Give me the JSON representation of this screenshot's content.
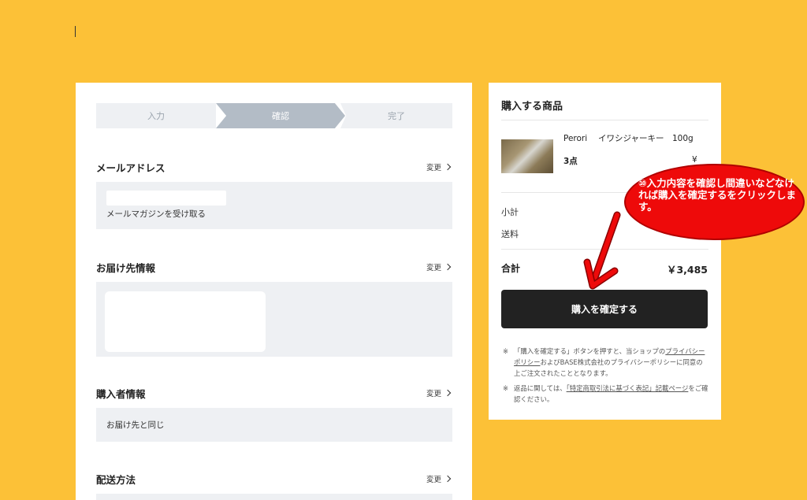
{
  "steps": [
    "入力",
    "確認",
    "完了"
  ],
  "left": {
    "change_label": "変更",
    "email_section": {
      "title": "メールアドレス",
      "newsletter": "メールマガジンを受け取る"
    },
    "shipping_section": {
      "title": "お届け先情報"
    },
    "buyer_section": {
      "title": "購入者情報",
      "value": "お届け先と同じ"
    },
    "delivery_section": {
      "title": "配送方法"
    }
  },
  "right": {
    "title": "購入する商品",
    "product": {
      "name": "Perori　 イワシジャーキー　100g",
      "qty": "3点",
      "price_fragment": "¥"
    },
    "subtotal_label": "小計",
    "shipping_label": "送料",
    "total_label": "合計",
    "total_value": "￥3,485",
    "confirm_button": "購入を確定する",
    "note1_pre": "「購入を確定する」ボタンを押すと、当ショップの",
    "note1_link1": "プライバシーポリシー",
    "note1_mid": "およびBASE株式会社のプライバシーポリシーに同意の上ご注文されたこととなります。",
    "note2_pre": "返品に関しては、",
    "note2_link": "「特定商取引法に基づく表記」記載ページ",
    "note2_post": "をご確認ください。",
    "note_mark": "※"
  },
  "annotation": {
    "text": "⑩入力内容を確認し間違いなどなければ購入を確定するをクリックします。",
    "color": "#ee0a0a"
  },
  "colors": {
    "background": "#fcc137",
    "button": "#222222",
    "box": "#eef0f3"
  }
}
